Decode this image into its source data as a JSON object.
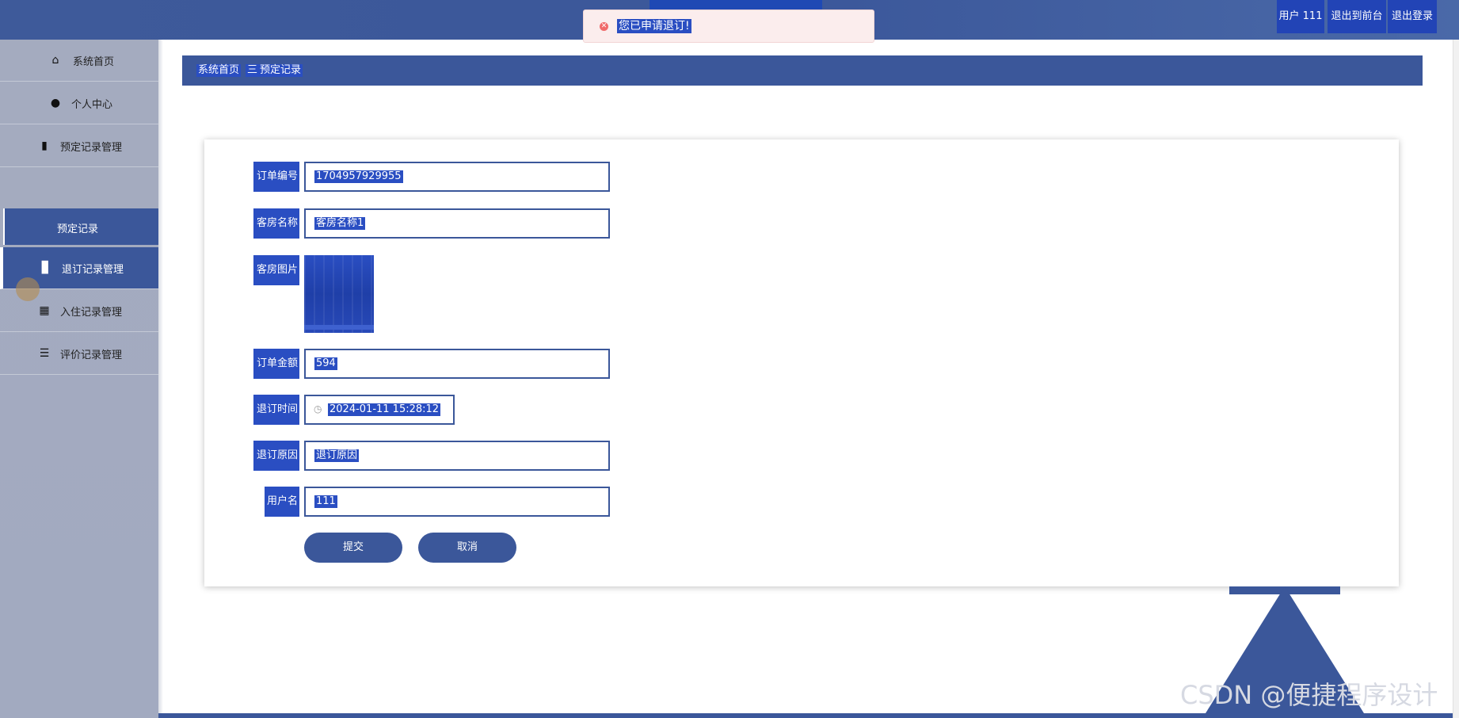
{
  "header": {
    "user_label": "用户 111",
    "exit_front_label": "退出到前台",
    "logout_label": "退出登录"
  },
  "toast": {
    "message": "您已申请退订!"
  },
  "sidebar": {
    "items": [
      {
        "label": "系统首页",
        "icon": "home-icon"
      },
      {
        "label": "个人中心",
        "icon": "user-icon"
      },
      {
        "label": "预定记录管理",
        "icon": "clipboard-icon"
      },
      {
        "label": "预定记录",
        "icon": ""
      },
      {
        "label": "退订记录管理",
        "icon": "bar-chart-icon"
      },
      {
        "label": "入住记录管理",
        "icon": "grid-icon"
      },
      {
        "label": "评价记录管理",
        "icon": "list-icon"
      }
    ]
  },
  "breadcrumb": {
    "home": "系统首页",
    "separator": "三",
    "current": "预定记录"
  },
  "form": {
    "order_no": {
      "label": "订单编号",
      "value": "1704957929955"
    },
    "room_name": {
      "label": "客房名称",
      "value": "客房名称1"
    },
    "room_image": {
      "label": "客房图片"
    },
    "amount": {
      "label": "订单金额",
      "value": "594"
    },
    "cancel_time": {
      "label": "退订时间",
      "value": "2024-01-11 15:28:12"
    },
    "cancel_reason": {
      "label": "退订原因",
      "value": "退订原因"
    },
    "username": {
      "label": "用户名",
      "value": "111"
    },
    "submit_label": "提交",
    "cancel_label": "取消"
  },
  "watermark": "CSDN @便捷程序设计",
  "colors": {
    "primary": "#3b579a",
    "highlight": "#2a4ec2",
    "sidebar": "#a4abbf"
  }
}
